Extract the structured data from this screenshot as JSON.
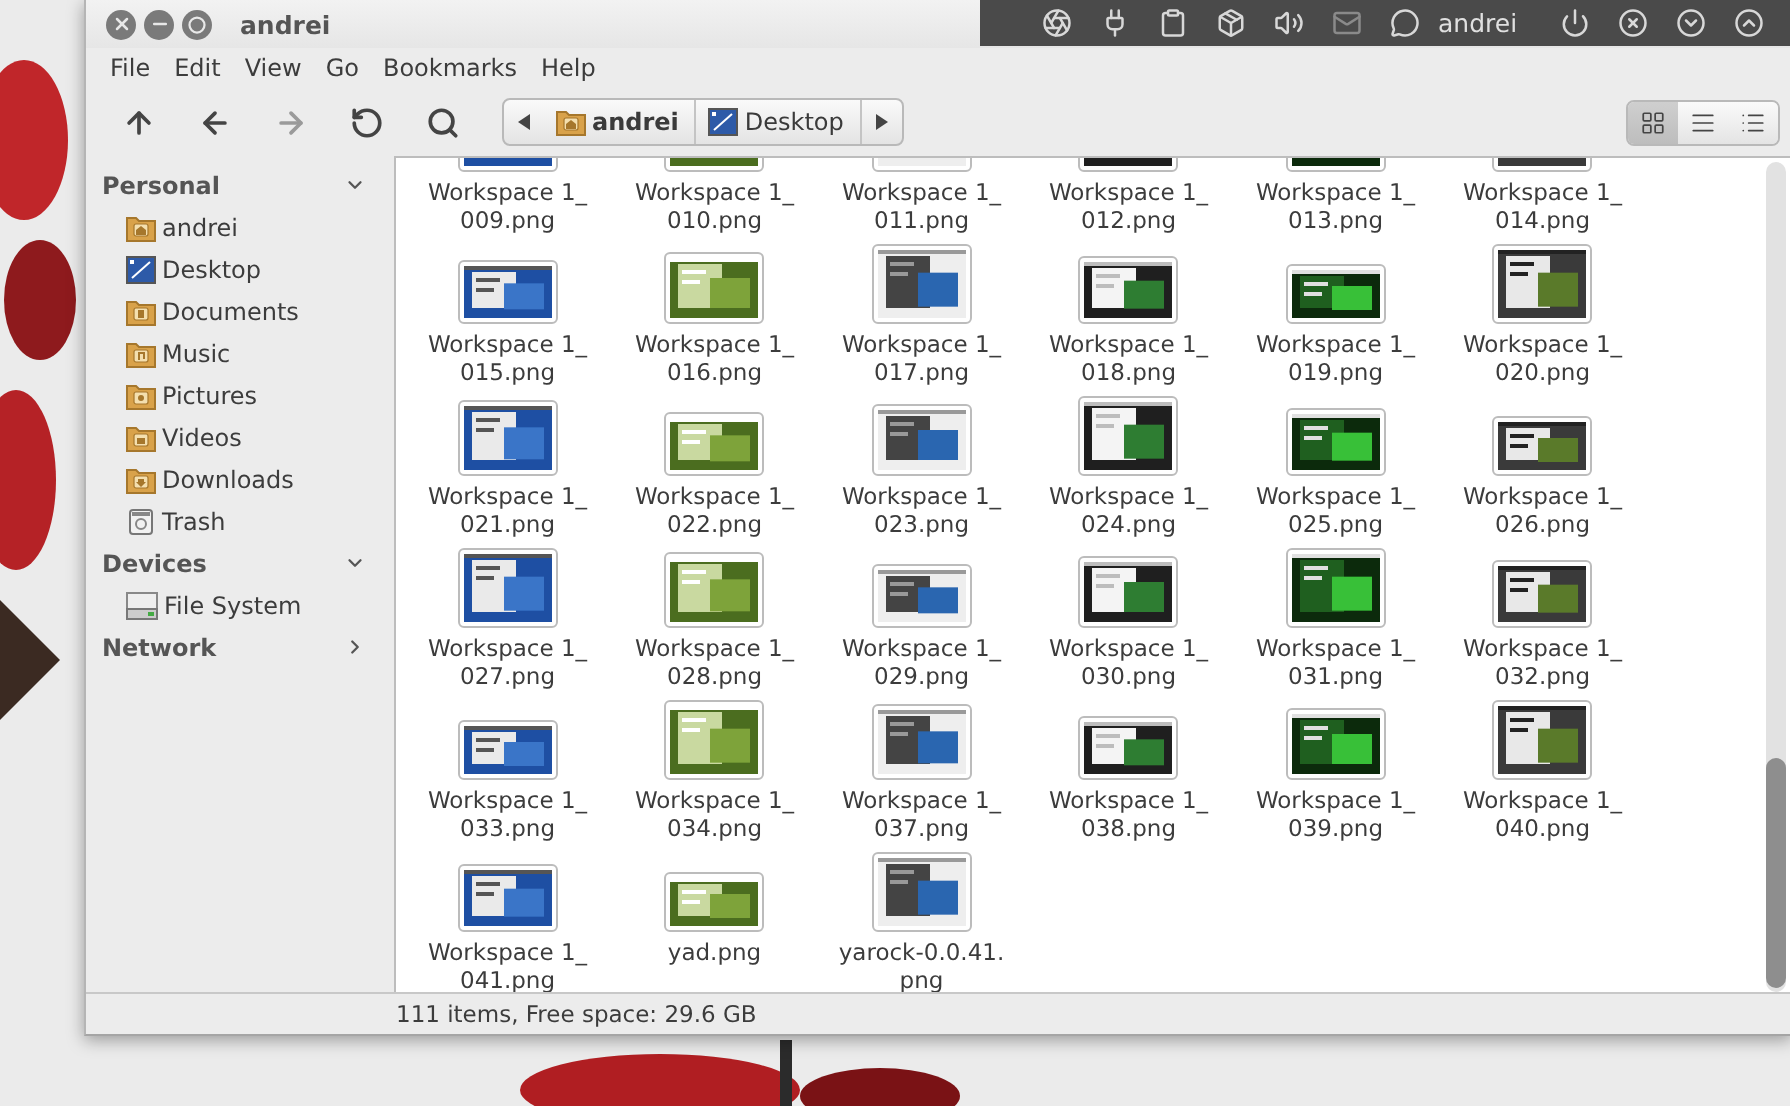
{
  "window": {
    "title": "andrei",
    "controls": [
      {
        "kind": "close"
      },
      {
        "kind": "minimize"
      },
      {
        "kind": "maximize"
      }
    ]
  },
  "panel": {
    "indicators": [
      {
        "kind": "aperture"
      },
      {
        "kind": "plug"
      },
      {
        "kind": "clipboard"
      },
      {
        "kind": "box"
      },
      {
        "kind": "volume"
      },
      {
        "kind": "mail"
      },
      {
        "kind": "chat"
      }
    ],
    "user": "andrei",
    "actions": [
      {
        "kind": "power"
      },
      {
        "kind": "close"
      },
      {
        "kind": "down"
      },
      {
        "kind": "up"
      }
    ]
  },
  "menu": [
    "File",
    "Edit",
    "View",
    "Go",
    "Bookmarks",
    "Help"
  ],
  "toolbar": {
    "buttons": [
      {
        "kind": "up",
        "disabled": false
      },
      {
        "kind": "back",
        "disabled": false
      },
      {
        "kind": "forward",
        "disabled": true
      },
      {
        "kind": "reload",
        "disabled": false
      },
      {
        "kind": "search",
        "disabled": false
      }
    ],
    "breadcrumb": [
      {
        "label": "andrei",
        "kind": "home",
        "selected": true
      },
      {
        "label": "Desktop",
        "kind": "desktop",
        "selected": false
      }
    ],
    "views": [
      {
        "kind": "icons",
        "selected": true
      },
      {
        "kind": "list",
        "selected": false
      },
      {
        "kind": "compact",
        "selected": false
      }
    ]
  },
  "sidebar": [
    {
      "title": "Personal",
      "expanded": true,
      "items": [
        {
          "label": "andrei",
          "kind": "home"
        },
        {
          "label": "Desktop",
          "kind": "desktop"
        },
        {
          "label": "Documents",
          "kind": "documents"
        },
        {
          "label": "Music",
          "kind": "music"
        },
        {
          "label": "Pictures",
          "kind": "pictures"
        },
        {
          "label": "Videos",
          "kind": "videos"
        },
        {
          "label": "Downloads",
          "kind": "downloads"
        },
        {
          "label": "Trash",
          "kind": "trash"
        }
      ]
    },
    {
      "title": "Devices",
      "expanded": true,
      "items": [
        {
          "label": "File System",
          "kind": "drive"
        }
      ]
    },
    {
      "title": "Network",
      "expanded": false
    }
  ],
  "files": [
    {
      "lines": [
        "Workspace 1_",
        "009.png"
      ]
    },
    {
      "lines": [
        "Workspace 1_",
        "010.png"
      ]
    },
    {
      "lines": [
        "Workspace 1_",
        "011.png"
      ]
    },
    {
      "lines": [
        "Workspace 1_",
        "012.png"
      ]
    },
    {
      "lines": [
        "Workspace 1_",
        "013.png"
      ]
    },
    {
      "lines": [
        "Workspace 1_",
        "014.png"
      ]
    },
    {
      "lines": [
        "Workspace 1_",
        "015.png"
      ]
    },
    {
      "lines": [
        "Workspace 1_",
        "016.png"
      ]
    },
    {
      "lines": [
        "Workspace 1_",
        "017.png"
      ]
    },
    {
      "lines": [
        "Workspace 1_",
        "018.png"
      ]
    },
    {
      "lines": [
        "Workspace 1_",
        "019.png"
      ]
    },
    {
      "lines": [
        "Workspace 1_",
        "020.png"
      ]
    },
    {
      "lines": [
        "Workspace 1_",
        "021.png"
      ]
    },
    {
      "lines": [
        "Workspace 1_",
        "022.png"
      ]
    },
    {
      "lines": [
        "Workspace 1_",
        "023.png"
      ]
    },
    {
      "lines": [
        "Workspace 1_",
        "024.png"
      ]
    },
    {
      "lines": [
        "Workspace 1_",
        "025.png"
      ]
    },
    {
      "lines": [
        "Workspace 1_",
        "026.png"
      ]
    },
    {
      "lines": [
        "Workspace 1_",
        "027.png"
      ]
    },
    {
      "lines": [
        "Workspace 1_",
        "028.png"
      ]
    },
    {
      "lines": [
        "Workspace 1_",
        "029.png"
      ]
    },
    {
      "lines": [
        "Workspace 1_",
        "030.png"
      ]
    },
    {
      "lines": [
        "Workspace 1_",
        "031.png"
      ]
    },
    {
      "lines": [
        "Workspace 1_",
        "032.png"
      ]
    },
    {
      "lines": [
        "Workspace 1_",
        "033.png"
      ]
    },
    {
      "lines": [
        "Workspace 1_",
        "034.png"
      ]
    },
    {
      "lines": [
        "Workspace 1_",
        "037.png"
      ]
    },
    {
      "lines": [
        "Workspace 1_",
        "038.png"
      ]
    },
    {
      "lines": [
        "Workspace 1_",
        "039.png"
      ]
    },
    {
      "lines": [
        "Workspace 1_",
        "040.png"
      ]
    },
    {
      "lines": [
        "Workspace 1_",
        "041.png"
      ]
    },
    {
      "lines": [
        "yad.png"
      ]
    },
    {
      "lines": [
        "yarock-0.0.41.",
        "png"
      ]
    }
  ],
  "status_bar": "111 items, Free space: 29.6 GB"
}
